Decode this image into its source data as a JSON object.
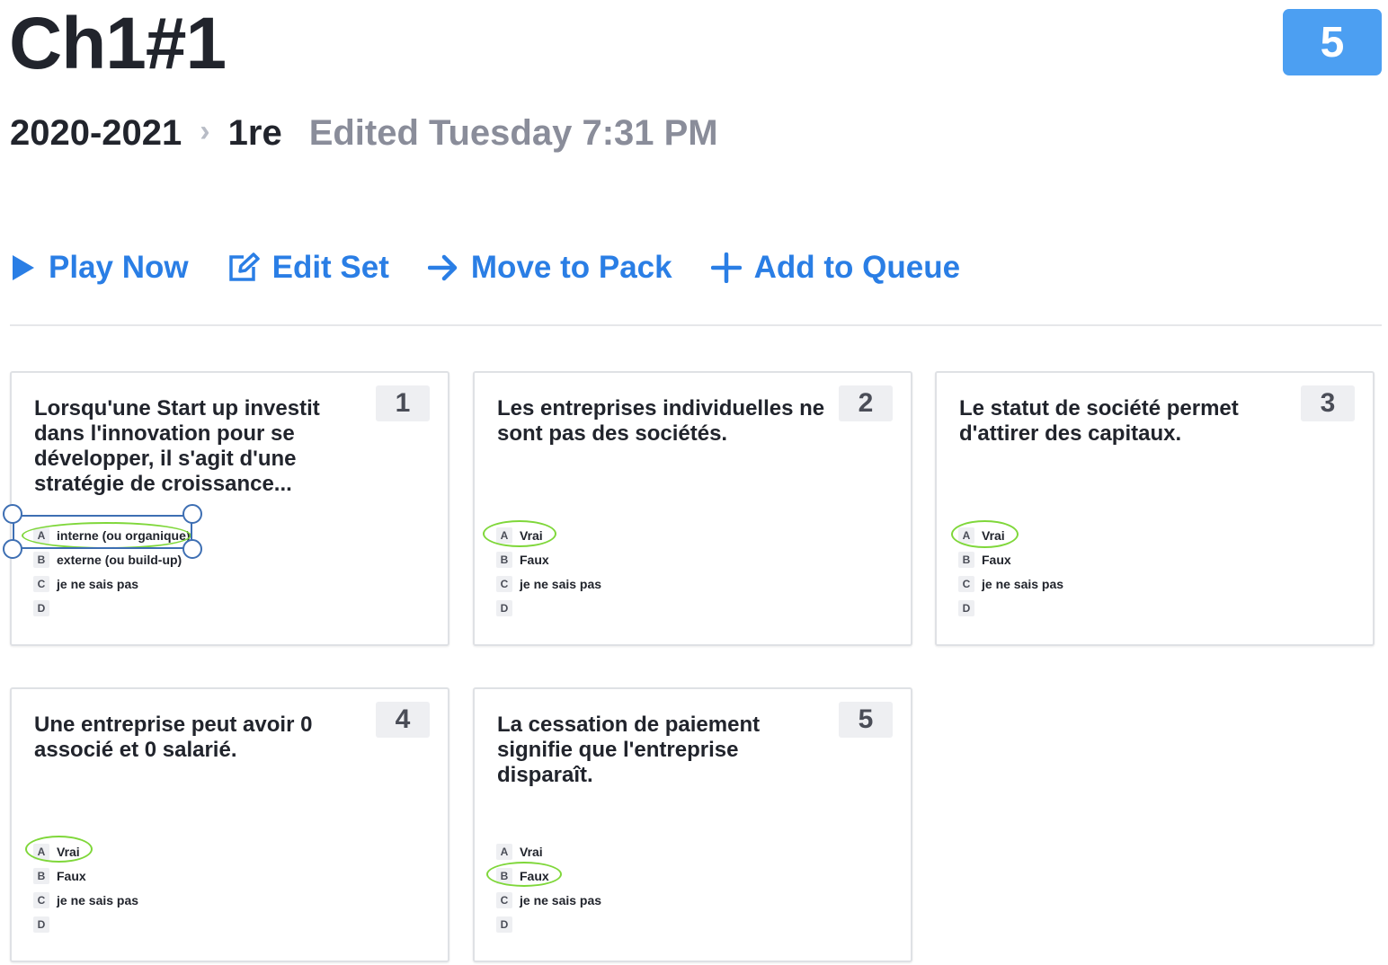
{
  "set": {
    "title": "Ch1#1",
    "question_count": "5",
    "year": "2020-2021",
    "separator": "›",
    "level": "1re",
    "edited": "Edited Tuesday 7:31 PM"
  },
  "actions": {
    "play": "Play Now",
    "edit": "Edit Set",
    "move": "Move to Pack",
    "queue": "Add to Queue"
  },
  "accent_color": "#2a7ee5",
  "badge_color": "#4c9ff2",
  "highlight_color": "#7fd73a",
  "questions": [
    {
      "number": "1",
      "text": "Lorsqu'une Start up investit dans l'innovation pour se développer, il s'agit d'une stratégie de croissance...",
      "answers": [
        {
          "letter": "A",
          "text": "interne (ou organique)"
        },
        {
          "letter": "B",
          "text": "externe (ou build-up)"
        },
        {
          "letter": "C",
          "text": "je ne sais pas"
        },
        {
          "letter": "D",
          "text": ""
        }
      ],
      "circled": "A"
    },
    {
      "number": "2",
      "text": "Les entreprises individuelles ne sont pas des sociétés.",
      "answers": [
        {
          "letter": "A",
          "text": "Vrai"
        },
        {
          "letter": "B",
          "text": "Faux"
        },
        {
          "letter": "C",
          "text": "je ne sais pas"
        },
        {
          "letter": "D",
          "text": ""
        }
      ],
      "circled": "A"
    },
    {
      "number": "3",
      "text": "Le statut de société permet d'attirer des capitaux.",
      "answers": [
        {
          "letter": "A",
          "text": "Vrai"
        },
        {
          "letter": "B",
          "text": "Faux"
        },
        {
          "letter": "C",
          "text": "je ne sais pas"
        },
        {
          "letter": "D",
          "text": ""
        }
      ],
      "circled": "A"
    },
    {
      "number": "4",
      "text": "Une entreprise peut avoir 0 associé et 0 salarié.",
      "answers": [
        {
          "letter": "A",
          "text": "Vrai"
        },
        {
          "letter": "B",
          "text": "Faux"
        },
        {
          "letter": "C",
          "text": "je ne sais pas"
        },
        {
          "letter": "D",
          "text": ""
        }
      ],
      "circled": "A"
    },
    {
      "number": "5",
      "text": "La cessation de paiement signifie que l'entreprise disparaît.",
      "answers": [
        {
          "letter": "A",
          "text": "Vrai"
        },
        {
          "letter": "B",
          "text": "Faux"
        },
        {
          "letter": "C",
          "text": "je ne sais pas"
        },
        {
          "letter": "D",
          "text": ""
        }
      ],
      "circled": "B"
    }
  ]
}
